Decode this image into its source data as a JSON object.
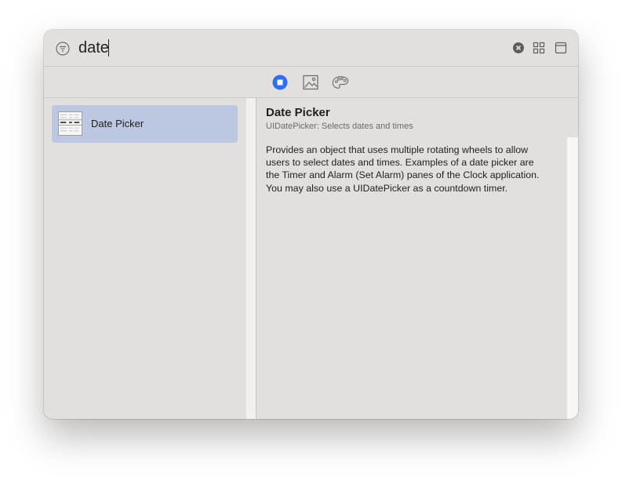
{
  "search": {
    "value": "date",
    "placeholder": "Filter"
  },
  "toolbar": {
    "icons": [
      "objects-icon",
      "media-icon",
      "colors-icon"
    ],
    "accent": "#2f6ef5"
  },
  "list": {
    "items": [
      {
        "label": "Date Picker",
        "thumb": "date-picker-thumbnail"
      }
    ],
    "selected_color": "#bcc8e2"
  },
  "detail": {
    "title": "Date Picker",
    "subtitle": "UIDatePicker: Selects dates and times",
    "description": "Provides an object that uses multiple rotating wheels to allow users to select dates and times. Examples of a date picker are the Timer and Alarm (Set Alarm) panes of the Clock application. You may also use a UIDatePicker as a countdown timer."
  }
}
